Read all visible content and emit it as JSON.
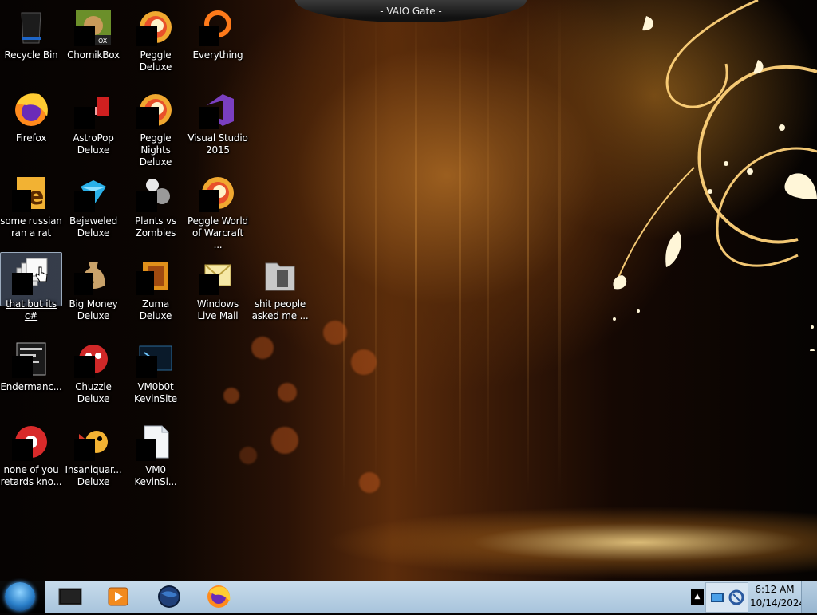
{
  "window": {
    "title": "- VAIO Gate -"
  },
  "desktop": {
    "icons": [
      {
        "label": "Recycle Bin",
        "icon": "recycle-bin-icon"
      },
      {
        "label": "ChomikBox",
        "icon": "chomikbox-icon"
      },
      {
        "label": "Peggle Deluxe",
        "icon": "peggle-deluxe-icon"
      },
      {
        "label": "Everything",
        "icon": "everything-search-icon"
      },
      {
        "label": "Firefox",
        "icon": "firefox-icon"
      },
      {
        "label": "AstroPop Deluxe",
        "icon": "astropop-icon"
      },
      {
        "label": "Peggle Nights Deluxe",
        "icon": "peggle-nights-icon"
      },
      {
        "label": "Visual Studio 2015",
        "icon": "visual-studio-icon"
      },
      {
        "label": "some russian ran a rat",
        "icon": "file-e-icon"
      },
      {
        "label": "Bejeweled Deluxe",
        "icon": "bejeweled-icon"
      },
      {
        "label": "Plants vs Zombies",
        "icon": "plants-vs-zombies-icon"
      },
      {
        "label": "Peggle World of Warcraft ...",
        "icon": "peggle-wow-icon"
      },
      {
        "label": "that.but its c#",
        "icon": "stacked-windows-icon",
        "selected": true
      },
      {
        "label": "Big Money Deluxe",
        "icon": "money-bag-icon"
      },
      {
        "label": "Zuma Deluxe",
        "icon": "zuma-icon"
      },
      {
        "label": "Windows Live Mail",
        "icon": "live-mail-icon"
      },
      {
        "label": "shit people asked me ...",
        "icon": "folder-icon"
      },
      {
        "label": "Endermanc...",
        "icon": "text-document-icon"
      },
      {
        "label": "Chuzzle Deluxe",
        "icon": "chuzzle-icon"
      },
      {
        "label": "VM0b0t KevinSite",
        "icon": "terminal-icon"
      },
      {
        "label": "none of you retards kno...",
        "icon": "chrome-like-icon"
      },
      {
        "label": "Insaniquar... Deluxe",
        "icon": "insaniquarium-icon"
      },
      {
        "label": "VM0 KevinSi...",
        "icon": "blank-file-icon"
      }
    ]
  },
  "taskbar": {
    "start": {
      "icon": "windows-start-orb-icon"
    },
    "pinned": [
      {
        "icon": "dark-box-app-icon"
      },
      {
        "icon": "media-player-icon"
      },
      {
        "icon": "globe-app-icon"
      },
      {
        "icon": "firefox-icon"
      }
    ],
    "tray": {
      "overflow_label": "▲",
      "icons": [
        "network-icon",
        "sync-icon"
      ],
      "time": "6:12 AM",
      "date": "10/14/2024"
    }
  },
  "colors": {
    "taskbar_bg": "#a8c4dc",
    "label_text": "#ffffff"
  }
}
